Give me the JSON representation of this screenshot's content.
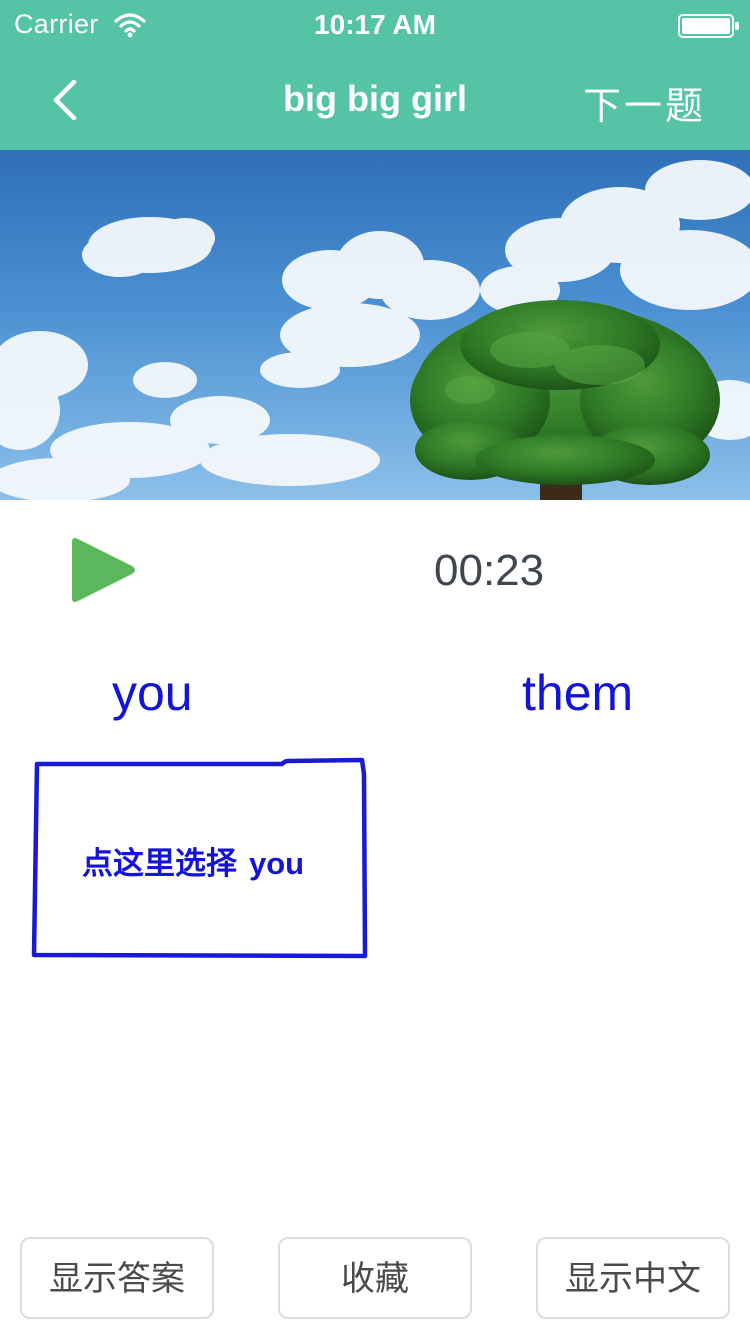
{
  "status_bar": {
    "carrier": "Carrier",
    "time": "10:17 AM"
  },
  "nav": {
    "title": "big big girl",
    "next_label": "下一题",
    "back_icon": "chevron-left-icon"
  },
  "hero": {
    "description_icon": "sky-tree-image"
  },
  "player": {
    "play_icon": "play-icon",
    "time": "00:23",
    "accent_color": "#5cb85c"
  },
  "options": [
    {
      "label": "you"
    },
    {
      "label": "them"
    }
  ],
  "hint": {
    "text": "点这里选择",
    "word": "you"
  },
  "bottom_buttons": {
    "show_answer": "显示答案",
    "favorite": "收藏",
    "show_chinese": "显示中文"
  },
  "colors": {
    "header": "#55c3a6",
    "option_text": "#1414d8",
    "annotation": "#1a1ad6"
  }
}
